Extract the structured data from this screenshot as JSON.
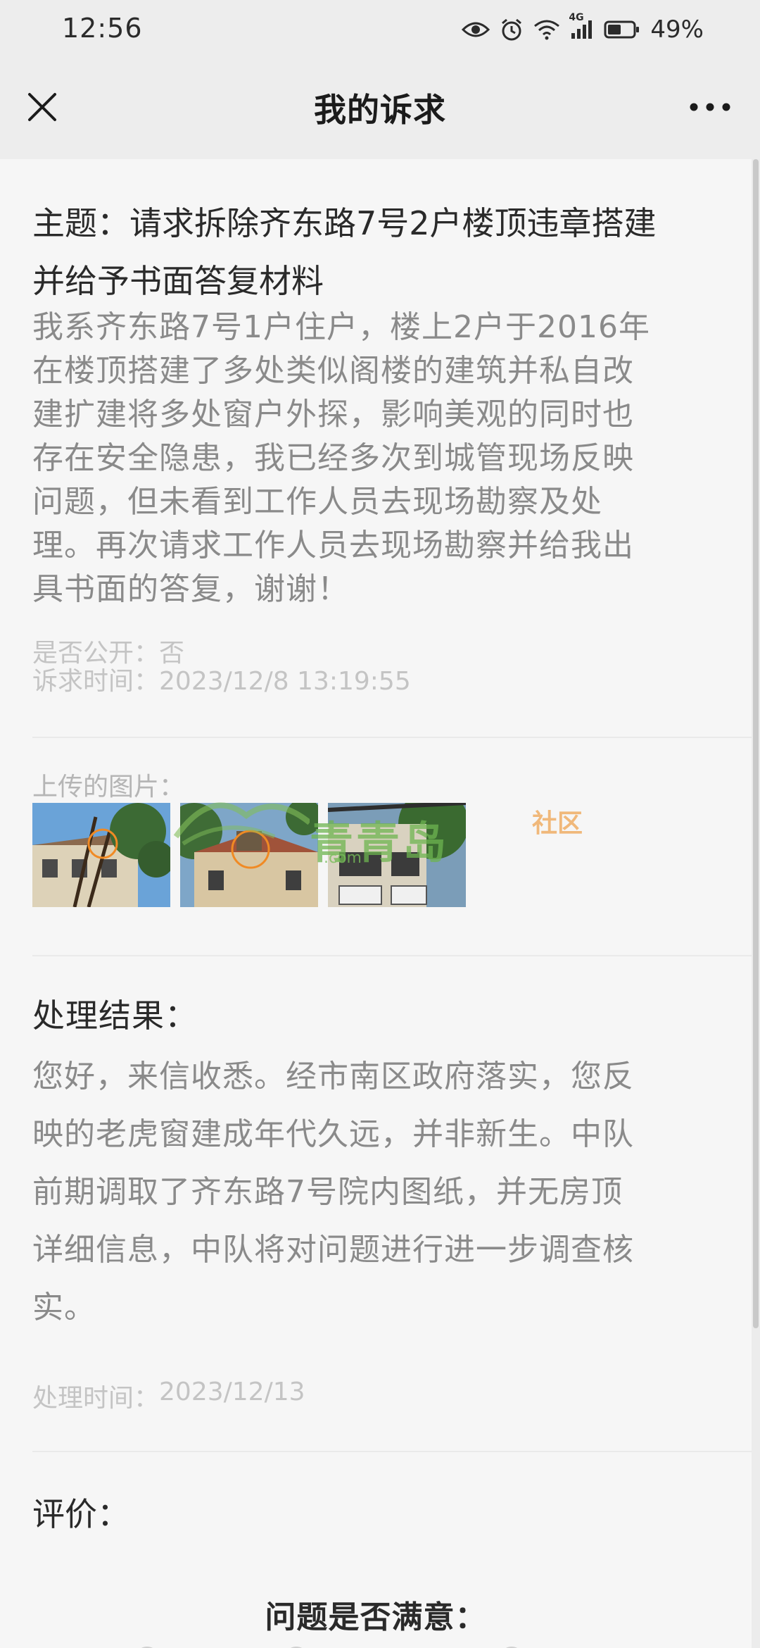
{
  "status_bar": {
    "time": "12:56",
    "network": "4G",
    "battery": "49%"
  },
  "nav": {
    "title": "我的诉求",
    "close_icon": "close-icon",
    "more_icon": "more-icon"
  },
  "petition": {
    "subject_line1": "主题：请求拆除齐东路7号2户楼顶违章搭建",
    "subject_line2": "并给予书面答复材料",
    "description_lines": [
      "我系齐东路7号1户住户，楼上2户于2016年",
      "在楼顶搭建了多处类似阁楼的建筑并私自改",
      "建扩建将多处窗户外探，影响美观的同时也",
      "存在安全隐患，我已经多次到城管现场反映",
      "问题，但未看到工作人员去现场勘察及处",
      "理。再次请求工作人员去现场勘察并给我出",
      "具书面的答复，谢谢！"
    ],
    "public_label": "是否公开：",
    "public_value": "否",
    "time_label": "诉求时间：",
    "time_value": "2023/12/8 13:19:55"
  },
  "uploads": {
    "label": "上传的图片：",
    "images": [
      "photo-1",
      "photo-2",
      "photo-3"
    ]
  },
  "watermark": {
    "site": "青青岛",
    "community": "社区",
    "url": ".com"
  },
  "result": {
    "title": "处理结果：",
    "lines": [
      "您好，来信收悉。经市南区政府落实，您反",
      "映的老虎窗建成年代久远，并非新生。中队",
      "前期调取了齐东路7号院内图纸，并无房顶",
      "详细信息，中队将对问题进行进一步调查核",
      "实。"
    ],
    "time_label": "处理时间：",
    "time_value": "2023/12/13"
  },
  "evaluation": {
    "title": "评价：",
    "question": "问题是否满意："
  },
  "colors": {
    "nav_bg": "#ededed",
    "page_bg": "#f6f6f6",
    "body_text": "#8a8a8a",
    "heading_text": "#2a2a2a",
    "meta_text": "#c4c4c4"
  }
}
